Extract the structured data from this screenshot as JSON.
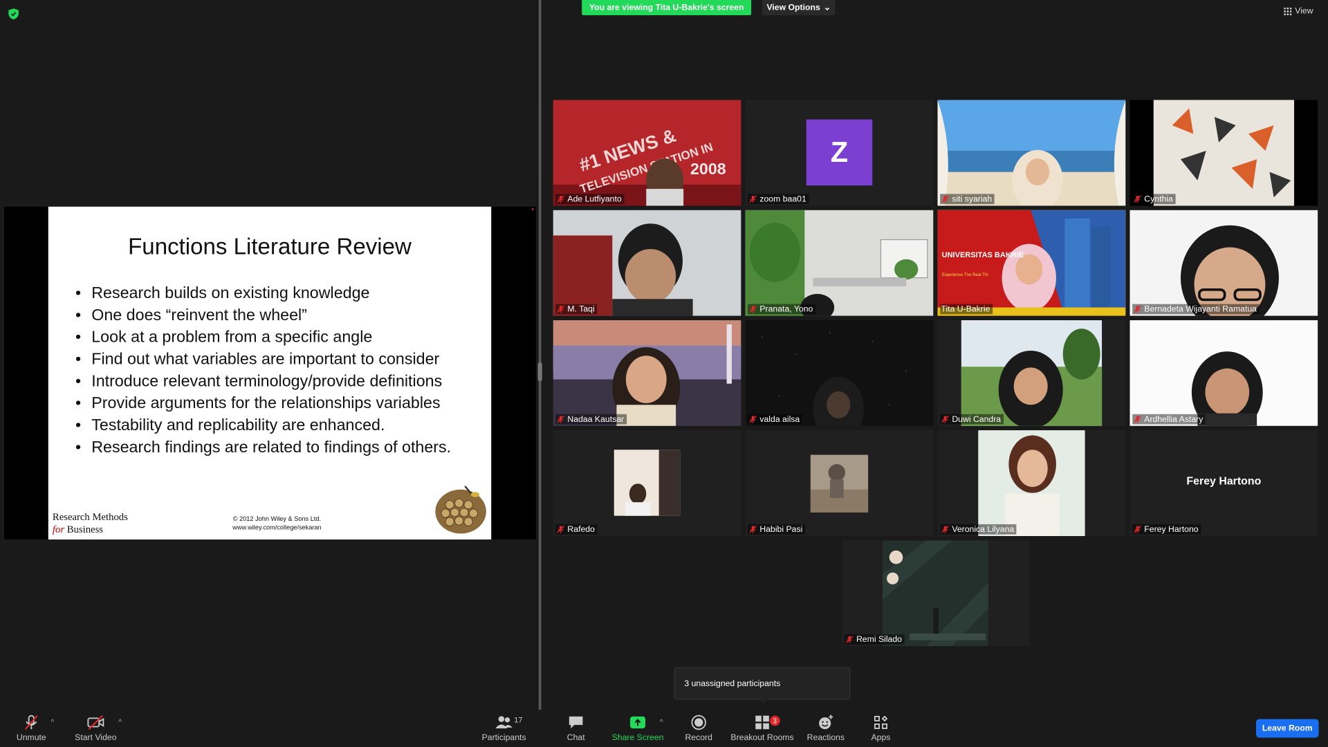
{
  "top_bar": {
    "banner_text": "You are viewing Tita U-Bakrie's screen",
    "view_options_label": "View Options",
    "view_label": "View"
  },
  "slide": {
    "title": "Functions Literature Review",
    "bullets": [
      "Research builds on existing knowledge",
      "One does “reinvent the wheel”",
      "Look at a problem from a specific angle",
      "Find out what variables are important to consider",
      "Introduce relevant terminology/provide definitions",
      "Provide arguments for the relationships variables",
      "Testability and replicability are enhanced.",
      "Research findings are related to findings of others."
    ],
    "footer_brand_line1": "Research Methods",
    "footer_brand_for": "for",
    "footer_brand_line2": "Business",
    "footer_copyright": "© 2012 John Wiley & Sons Ltd.",
    "footer_url": "www.wiley.com/college/sekaran"
  },
  "participants": [
    {
      "name": "Ade Lutfiyanto",
      "muted": true
    },
    {
      "name": "zoom baa01",
      "muted": true,
      "avatar_letter": "Z"
    },
    {
      "name": "siti syariah",
      "muted": true
    },
    {
      "name": "Cynthia",
      "muted": true
    },
    {
      "name": "M. Taqi",
      "muted": true
    },
    {
      "name": "Pranata, Yono",
      "muted": true
    },
    {
      "name": "Tita U-Bakrie",
      "muted": false,
      "active_speaker": true,
      "bg_text": "UNIVERSITAS BAKRIE",
      "bg_subtext": "Experience The Real Thi"
    },
    {
      "name": "Bernadeta Wijayanti Ramatua",
      "muted": true
    },
    {
      "name": "Nadaa Kautsar",
      "muted": true
    },
    {
      "name": "valda ailsa",
      "muted": true
    },
    {
      "name": "Duwi Candra",
      "muted": true
    },
    {
      "name": "Ardhellia Astary",
      "muted": true
    },
    {
      "name": "Rafedo",
      "muted": true
    },
    {
      "name": "Habibi Pasi",
      "muted": true
    },
    {
      "name": "Veronica Lilyana",
      "muted": true
    },
    {
      "name": "Ferey Hartono",
      "muted": true,
      "display_name_center": "Ferey Hartono"
    },
    {
      "name": "Remi Silado",
      "muted": true
    }
  ],
  "tile_backgrounds": {
    "ade_text_1": "#1 NEWS &",
    "ade_text_2": "TELEVISION STATION IN",
    "ade_text_3": "2008"
  },
  "popup": {
    "text": "3 unassigned participants"
  },
  "toolbar": {
    "unmute": "Unmute",
    "start_video": "Start Video",
    "participants": "Participants",
    "participants_count": "17",
    "chat": "Chat",
    "share_screen": "Share Screen",
    "record": "Record",
    "breakout_rooms": "Breakout Rooms",
    "breakout_count": "3",
    "reactions": "Reactions",
    "apps": "Apps",
    "leave_room": "Leave Room"
  },
  "colors": {
    "banner_green": "#23d959",
    "leave_blue": "#1a6ef0",
    "active_speaker_border": "#e8e56a",
    "mute_red": "#e02828",
    "avatar_purple": "#7b3fd1"
  }
}
